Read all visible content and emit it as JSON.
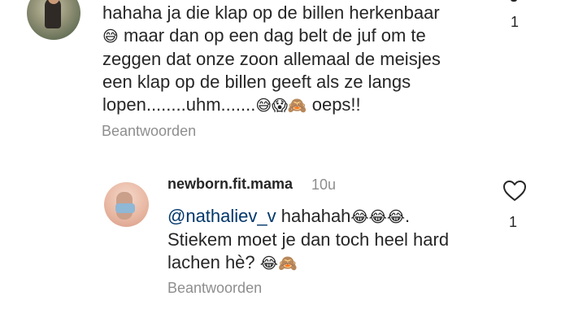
{
  "comment1": {
    "lines": [
      "hahaha ja die klap op de billen herkenbaar",
      "maar dan op een dag belt de juf om te",
      "zeggen dat onze zoon allemaal de meisjes",
      "een klap op de billen geeft als ze langs",
      "lopen........uhm.......",
      "oeps!!"
    ],
    "emoji_line2": "😅",
    "emoji_line5": "😅😱🙈",
    "reply_label": "Beantwoorden",
    "like_count": "1"
  },
  "comment2": {
    "username": "newborn.fit.mama",
    "time_ago": "10u",
    "mention": "@nathaliev_v",
    "text_line1": "hahahah",
    "emoji_line1": "😂😂😂",
    "text_line1_end": ".",
    "text_line2": "Stiekem moet je dan toch heel hard",
    "text_line3": "lachen hè?",
    "emoji_line3": "😂🙈",
    "reply_label": "Beantwoorden",
    "like_count": "1"
  },
  "icons": {
    "like": "heart-outline-icon"
  }
}
